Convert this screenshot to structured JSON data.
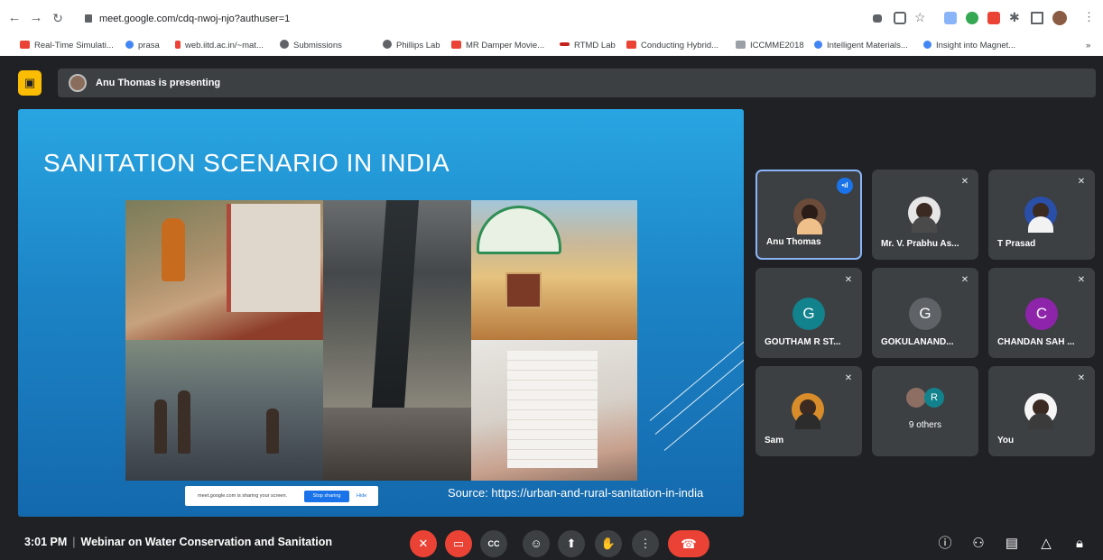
{
  "browser": {
    "url": "meet.google.com/cdq-nwoj-njo?authuser=1",
    "bookmarks": [
      {
        "label": "Real-Time Simulati...",
        "color": "#ea4335"
      },
      {
        "label": "prasa",
        "color": "#4285f4"
      },
      {
        "label": "web.iitd.ac.in/~mat...",
        "color": "#ea4335"
      },
      {
        "label": "Submissions",
        "color": "#5f6368"
      },
      {
        "label": "Phillips Lab",
        "color": "#5f6368"
      },
      {
        "label": "MR Damper Movie...",
        "color": "#ea4335"
      },
      {
        "label": "RTMD Lab",
        "color": "#c5221f"
      },
      {
        "label": "Conducting Hybrid...",
        "color": "#ea4335"
      },
      {
        "label": "ICCMME2018",
        "color": "#5f6368"
      },
      {
        "label": "Intelligent Materials...",
        "color": "#4285f4"
      },
      {
        "label": "Insight into Magnet...",
        "color": "#4285f4"
      }
    ],
    "more_bookmarks": "»"
  },
  "meet": {
    "presenting_text": "Anu Thomas is presenting",
    "slide": {
      "title": "SANITATION SCENARIO IN INDIA",
      "source": "Source:  https://urban-and-rural-sanitation-in-india"
    },
    "share_bar": {
      "text": "meet.google.com is sharing your screen.",
      "stop_label": "Stop sharing",
      "hide_label": "Hide"
    },
    "participants": [
      {
        "name": "Anu Thomas",
        "type": "photo",
        "speaking": true,
        "color": "#f0c08a"
      },
      {
        "name": "Mr. V. Prabhu As...",
        "type": "photo",
        "muted": true,
        "color": "#ffffff"
      },
      {
        "name": "T Prasad",
        "type": "photo",
        "muted": true,
        "color": "#2a4fa8"
      },
      {
        "name": "GOUTHAM R ST...",
        "type": "letter",
        "letter": "G",
        "muted": true,
        "color": "#12828c"
      },
      {
        "name": "GOKULANAND...",
        "type": "letter",
        "letter": "G",
        "muted": true,
        "color": "#5f6368"
      },
      {
        "name": "CHANDAN SAH ...",
        "type": "letter",
        "letter": "C",
        "muted": true,
        "color": "#8e24aa"
      },
      {
        "name": "Sam",
        "type": "photo",
        "muted": true,
        "color": "#d98c2a"
      },
      {
        "name": "9 others",
        "type": "group",
        "letter": "R",
        "color": "#12828c"
      },
      {
        "name": "You",
        "type": "photo",
        "muted": true,
        "color": "#ffffff"
      }
    ],
    "bottom": {
      "time": "3:01 PM",
      "separator": "|",
      "meeting_title": "Webinar on Water Conservation and Sanitation"
    }
  }
}
